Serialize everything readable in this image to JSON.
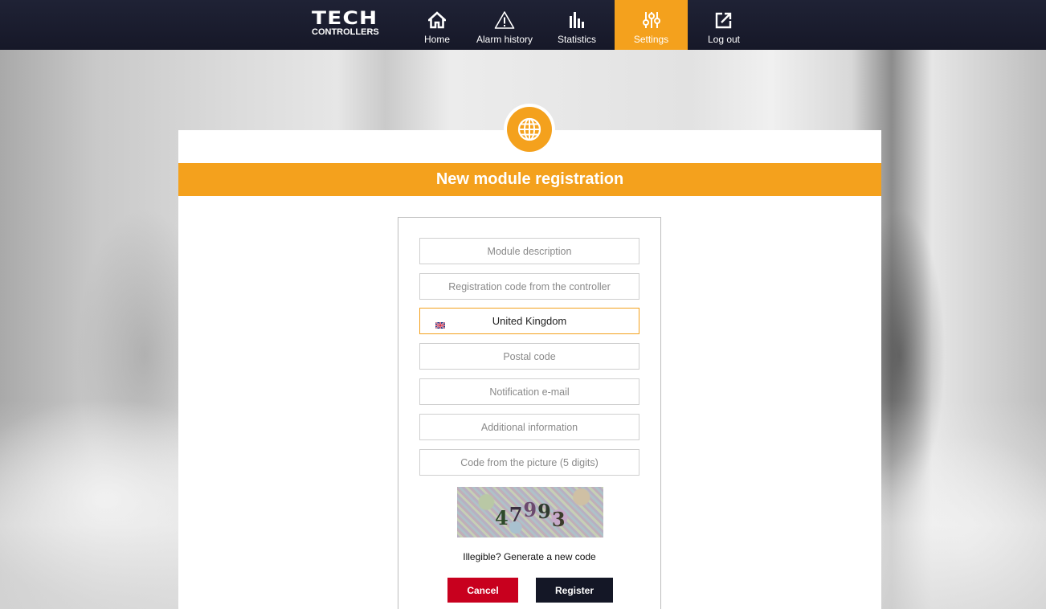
{
  "brand": {
    "logo_top": "TECH",
    "logo_bottom": "CONTROLLERS"
  },
  "nav": {
    "items": [
      {
        "label": "Home",
        "icon": "home-icon",
        "active": false
      },
      {
        "label": "Alarm history",
        "icon": "warning-icon",
        "active": false
      },
      {
        "label": "Statistics",
        "icon": "bar-chart-icon",
        "active": false
      },
      {
        "label": "Settings",
        "icon": "sliders-icon",
        "active": true
      },
      {
        "label": "Log out",
        "icon": "logout-icon",
        "active": false
      }
    ]
  },
  "page": {
    "title": "New module registration",
    "badge_icon": "globe-icon"
  },
  "form": {
    "module_description": {
      "placeholder": "Module description",
      "value": ""
    },
    "registration_code": {
      "placeholder": "Registration code from the controller",
      "value": ""
    },
    "country": {
      "value": "United Kingdom",
      "flag_icon": "uk-flag-icon"
    },
    "postal_code": {
      "placeholder": "Postal code",
      "value": ""
    },
    "notification_email": {
      "placeholder": "Notification e-mail",
      "value": ""
    },
    "additional_info": {
      "placeholder": "Additional information",
      "value": ""
    },
    "captcha_code": {
      "placeholder": "Code from the picture (5 digits)",
      "value": ""
    },
    "captcha_image_text": "47993",
    "regenerate_link": "Illegible? Generate a new code",
    "cancel_label": "Cancel",
    "register_label": "Register"
  },
  "colors": {
    "accent": "#f4a11d",
    "nav_bg": "#1a1d2e",
    "cancel": "#c8001e",
    "register": "#141726"
  }
}
